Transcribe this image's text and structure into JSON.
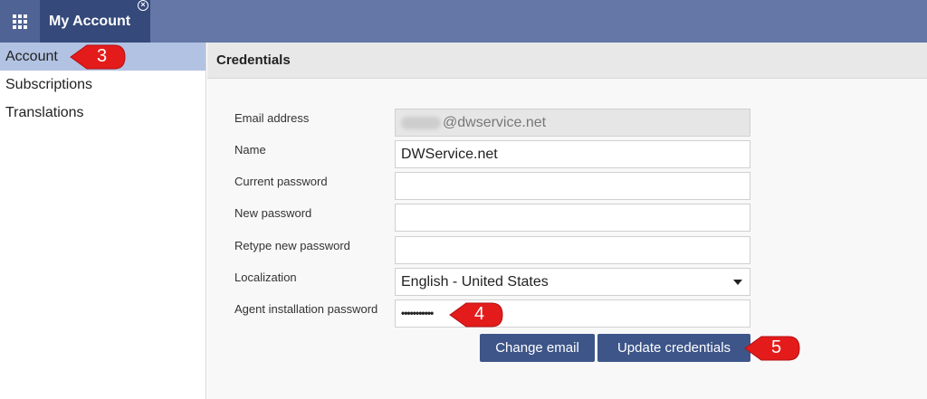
{
  "topbar": {
    "apps_icon": "apps-grid-icon",
    "active_tab": "My Account",
    "close_icon": "⊗"
  },
  "sidebar": {
    "items": [
      {
        "label": "Account",
        "active": true
      },
      {
        "label": "Subscriptions",
        "active": false
      },
      {
        "label": "Translations",
        "active": false
      }
    ]
  },
  "main": {
    "header": "Credentials",
    "fields": {
      "email": {
        "label": "Email address",
        "value": "@dwservice.net"
      },
      "name": {
        "label": "Name",
        "value": "DWService.net"
      },
      "current_password": {
        "label": "Current password",
        "value": ""
      },
      "new_password": {
        "label": "New password",
        "value": ""
      },
      "retype_password": {
        "label": "Retype new password",
        "value": ""
      },
      "localization": {
        "label": "Localization",
        "value": "English - United States"
      },
      "agent_password": {
        "label": "Agent installation password",
        "value": "•••••••••••"
      }
    },
    "buttons": {
      "change_email": "Change email",
      "update_credentials": "Update credentials"
    }
  },
  "callouts": [
    "3",
    "4",
    "5"
  ],
  "colors": {
    "topbar": "#6477a6",
    "active_tab": "#35497a",
    "sidebar_active": "#b2c2e2",
    "button": "#3d5589",
    "callout": "#e41b1b"
  }
}
